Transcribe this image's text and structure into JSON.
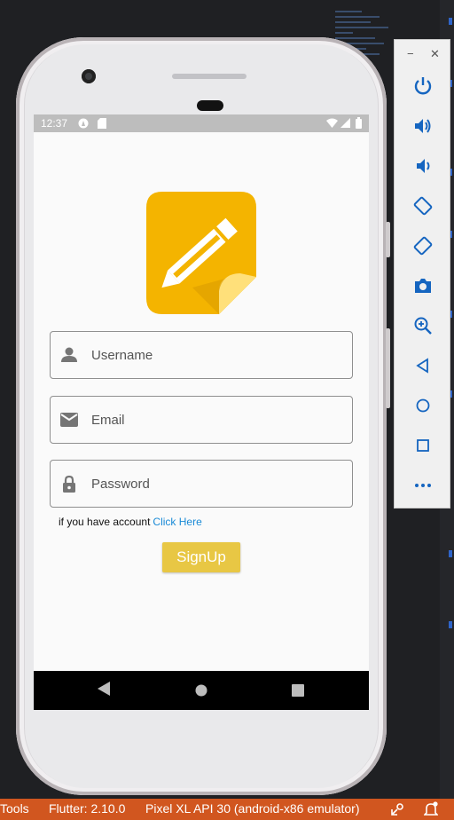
{
  "status_bar": {
    "time": "12:37"
  },
  "form": {
    "username_placeholder": "Username",
    "email_placeholder": "Email",
    "password_placeholder": "Password",
    "account_prompt": "if you have account",
    "account_link": "Click Here",
    "signup_label": "SignUp"
  },
  "ide_status": {
    "tools_label": "Tools",
    "flutter_version": "Flutter: 2.10.0",
    "device": "Pixel XL API 30 (android-x86 emulator)"
  },
  "colors": {
    "accent": "#e8c744",
    "logo_bg": "#f4b400",
    "link": "#1a8ad6",
    "ide_status_bg": "#d1561f"
  },
  "icons": {
    "status": [
      "wifi-icon",
      "signal-icon",
      "battery-icon"
    ],
    "fields": [
      "person-icon",
      "envelope-icon",
      "lock-icon"
    ],
    "emulator": [
      "power-icon",
      "volume-up-icon",
      "volume-down-icon",
      "rotate-left-icon",
      "rotate-right-icon",
      "camera-icon",
      "zoom-icon",
      "back-icon",
      "home-icon",
      "overview-icon",
      "more-icon"
    ]
  }
}
